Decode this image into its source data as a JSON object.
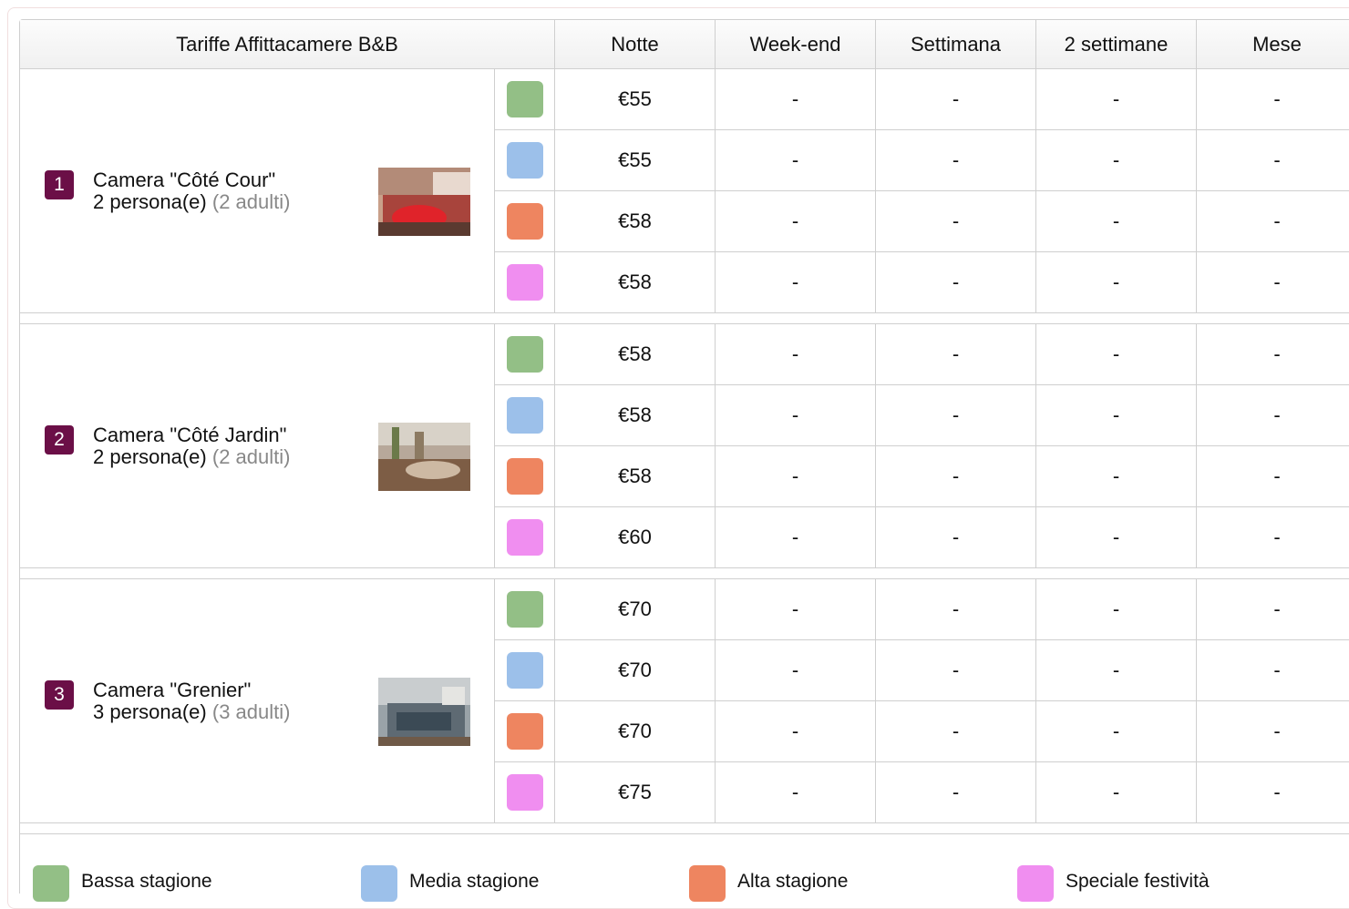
{
  "header": {
    "title": "Tariffe Affittacamere B&B",
    "columns": [
      "Notte",
      "Week-end",
      "Settimana",
      "2 settimane",
      "Mese"
    ]
  },
  "seasons": [
    {
      "key": "bassa",
      "label": "Bassa stagione",
      "color": "#93bf86"
    },
    {
      "key": "media",
      "label": "Media stagione",
      "color": "#9cc0ea"
    },
    {
      "key": "alta",
      "label": "Alta stagione",
      "color": "#ee8560"
    },
    {
      "key": "speciale",
      "label": "Speciale festività",
      "color": "#f08ef0"
    }
  ],
  "rooms": [
    {
      "number": "1",
      "name": "Camera \"Côté Cour\"",
      "capacity": "2 persona(e)",
      "adults": "(2 adulti)",
      "photo_icon": "room-photo-red-pillow",
      "rates": [
        {
          "notte": "€55",
          "weekend": "-",
          "settimana": "-",
          "due_settimane": "-",
          "mese": "-"
        },
        {
          "notte": "€55",
          "weekend": "-",
          "settimana": "-",
          "due_settimane": "-",
          "mese": "-"
        },
        {
          "notte": "€58",
          "weekend": "-",
          "settimana": "-",
          "due_settimane": "-",
          "mese": "-"
        },
        {
          "notte": "€58",
          "weekend": "-",
          "settimana": "-",
          "due_settimane": "-",
          "mese": "-"
        }
      ]
    },
    {
      "number": "2",
      "name": "Camera \"Côté Jardin\"",
      "capacity": "2 persona(e)",
      "adults": "(2 adulti)",
      "photo_icon": "room-photo-garden",
      "rates": [
        {
          "notte": "€58",
          "weekend": "-",
          "settimana": "-",
          "due_settimane": "-",
          "mese": "-"
        },
        {
          "notte": "€58",
          "weekend": "-",
          "settimana": "-",
          "due_settimane": "-",
          "mese": "-"
        },
        {
          "notte": "€58",
          "weekend": "-",
          "settimana": "-",
          "due_settimane": "-",
          "mese": "-"
        },
        {
          "notte": "€60",
          "weekend": "-",
          "settimana": "-",
          "due_settimane": "-",
          "mese": "-"
        }
      ]
    },
    {
      "number": "3",
      "name": "Camera \"Grenier\"",
      "capacity": "3 persona(e)",
      "adults": "(3 adulti)",
      "photo_icon": "room-photo-attic",
      "rates": [
        {
          "notte": "€70",
          "weekend": "-",
          "settimana": "-",
          "due_settimane": "-",
          "mese": "-"
        },
        {
          "notte": "€70",
          "weekend": "-",
          "settimana": "-",
          "due_settimane": "-",
          "mese": "-"
        },
        {
          "notte": "€70",
          "weekend": "-",
          "settimana": "-",
          "due_settimane": "-",
          "mese": "-"
        },
        {
          "notte": "€75",
          "weekend": "-",
          "settimana": "-",
          "due_settimane": "-",
          "mese": "-"
        }
      ]
    }
  ]
}
